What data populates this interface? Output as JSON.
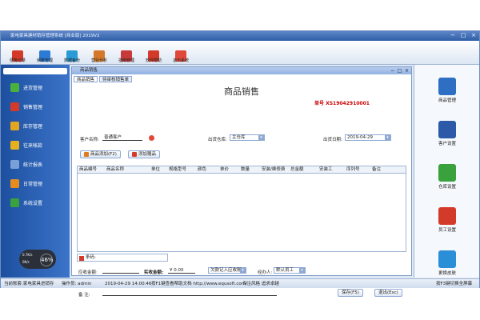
{
  "window": {
    "title": "家电家具建材销存管理系统 [商业版] 2019V2"
  },
  "toolbar": [
    {
      "label": "便笺记录",
      "color": "#d43a2a"
    },
    {
      "label": "频繁管理",
      "color": "#2b7bd4"
    },
    {
      "label": "数据备份",
      "color": "#2b9bd8"
    },
    {
      "label": "营业分析",
      "color": "#d4792a"
    },
    {
      "label": "指南管理",
      "color": "#c83a3a"
    },
    {
      "label": "软件帮助",
      "color": "#d43a2a"
    },
    {
      "label": "退出系统",
      "color": "#e0483a"
    }
  ],
  "leftnav": [
    {
      "label": "进货管理",
      "color": "#49b23c"
    },
    {
      "label": "销售管理",
      "color": "#d43a2a"
    },
    {
      "label": "库存管理",
      "color": "#e5a61f"
    },
    {
      "label": "往来帐款",
      "color": "#e5b11f"
    },
    {
      "label": "统计报表",
      "color": "#7aa0d8"
    },
    {
      "label": "日常管理",
      "color": "#e58c1f"
    },
    {
      "label": "系统设置",
      "color": "#3aa23c"
    }
  ],
  "rightpanel": [
    {
      "label": "商品管理",
      "color": "#2e6fc4"
    },
    {
      "label": "客户设置",
      "color": "#2d5aa8"
    },
    {
      "label": "仓库设置",
      "color": "#3aa23c"
    },
    {
      "label": "员工设置",
      "color": "#d43a2a"
    },
    {
      "label": "更换皮肤",
      "color": "#2b8fd8"
    }
  ],
  "gauge": {
    "value": "46",
    "pct": "%",
    "up": "0.7K/s",
    "down": "0K/s"
  },
  "subwindow": {
    "title": "商品销售",
    "tabs": [
      "商品销售",
      "待审核销售单"
    ],
    "form_title": "商品销售",
    "doc_no": "单号 XS19042910001",
    "customer_label": "客户名称:",
    "customer_value": "普通客户",
    "warehouse_label": "出货仓库:",
    "warehouse_value": "主仓库",
    "date_label": "出货日期:",
    "date_value": "2019-04-29",
    "add_product_btn": "商品添加(F2)",
    "add_gift_btn": "添加赠品",
    "columns": [
      "商品编号",
      "商品名称",
      "单位",
      "规格型号",
      "颜色",
      "单价",
      "数量",
      "安装/维修费",
      "总金额",
      "安装工",
      "序列号",
      "备注"
    ],
    "scan_label": "条码:",
    "total_label": "应收金额:",
    "paid_label": "实收金额:",
    "paid_value": "¥ 0.00",
    "payment_value": "欠款记入应收账",
    "handler_label": "经办人:",
    "handler_value": "默认员工",
    "remark_label": "备    注:",
    "save_btn": "保存(F5)",
    "exit_btn": "退出(Esc)"
  },
  "statusbar": {
    "company": "当前账套:家电家具进销存",
    "operator": "操作员: admin",
    "time": "2019-04-29 14:00:46",
    "help": "按F1键查看帮助文档 http://www.equsoft.com/",
    "slogan": "专注风格 追求卓越",
    "fullscreen": "按F3键切换全屏幕"
  }
}
